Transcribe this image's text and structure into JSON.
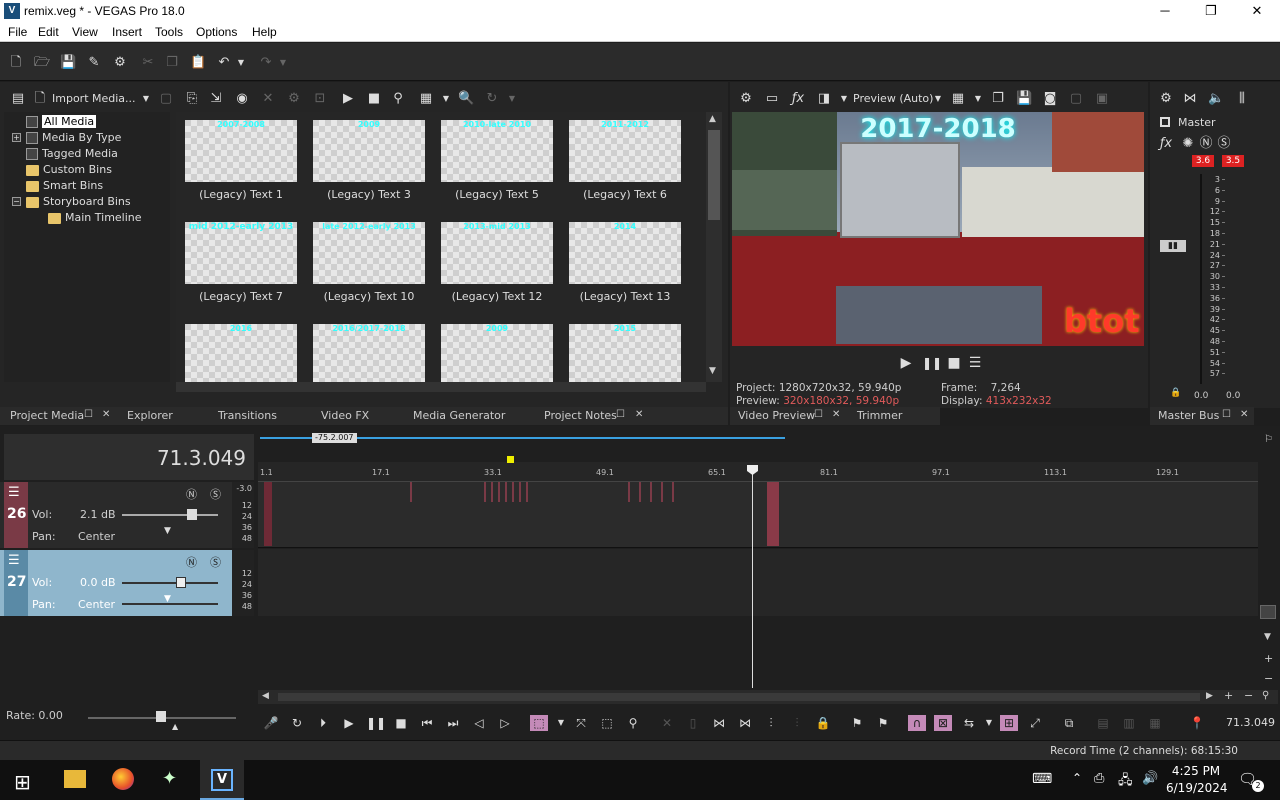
{
  "window": {
    "title": "remix.veg * - VEGAS Pro 18.0",
    "logo": "V",
    "minimize": "─",
    "maximize": "❐",
    "close": "✕"
  },
  "menu": [
    "File",
    "Edit",
    "View",
    "Insert",
    "Tools",
    "Options",
    "Help"
  ],
  "media_toolbar": {
    "import_label": "Import Media..."
  },
  "tree": {
    "items": [
      {
        "label": "All Media",
        "selected": true
      },
      {
        "label": "Media By Type",
        "expander": "+"
      },
      {
        "label": "Tagged Media"
      },
      {
        "label": "Custom Bins"
      },
      {
        "label": "Smart Bins"
      },
      {
        "label": "Storyboard Bins",
        "expander": "−"
      },
      {
        "label": "Main Timeline"
      }
    ]
  },
  "media": [
    {
      "thumb_text": "2007-2008",
      "label": "(Legacy) Text 1"
    },
    {
      "thumb_text": "2009",
      "label": "(Legacy) Text 3"
    },
    {
      "thumb_text": "2010-late 2010",
      "label": "(Legacy) Text 5"
    },
    {
      "thumb_text": "2011-2012",
      "label": "(Legacy) Text 6"
    },
    {
      "thumb_text": "mid 2012-early 2013",
      "label": "(Legacy) Text 7"
    },
    {
      "thumb_text": "late 2012-early 2013",
      "label": "(Legacy) Text 10"
    },
    {
      "thumb_text": "2013-mid 2013",
      "label": "(Legacy) Text 12"
    },
    {
      "thumb_text": "2014",
      "label": "(Legacy) Text 13"
    },
    {
      "thumb_text": "2016",
      "label": ""
    },
    {
      "thumb_text": "2016/2017-2018",
      "label": ""
    },
    {
      "thumb_text": "2009",
      "label": ""
    },
    {
      "thumb_text": "2015",
      "label": ""
    }
  ],
  "left_tabs": [
    "Project Media",
    "Explorer",
    "Transitions",
    "Video FX",
    "Media Generator",
    "Project Notes"
  ],
  "preview": {
    "mode": "Preview (Auto)",
    "overlay_year": "2017-2018",
    "overlay_logo": "btot",
    "project_label": "Project:",
    "project_value": "1280x720x32, 59.940p",
    "preview_label": "Preview:",
    "preview_value": "320x180x32, 59.940p",
    "frame_label": "Frame:",
    "frame_value": "7,264",
    "display_label": "Display:",
    "display_value": "413x232x32",
    "tabs": [
      "Video Preview",
      "Trimmer"
    ],
    "accent": "#e05a5a"
  },
  "master": {
    "label": "Master",
    "peak_left": "3.6",
    "peak_right": "3.5",
    "scale": [
      "3",
      "6",
      "9",
      "12",
      "15",
      "18",
      "21",
      "24",
      "27",
      "30",
      "33",
      "36",
      "39",
      "42",
      "45",
      "48",
      "51",
      "54",
      "57"
    ],
    "bottom_left": "0.0",
    "bottom_right": "0.0",
    "tab": "Master Bus"
  },
  "timeline": {
    "time": "71.3.049",
    "loop_label": "-75.2.007",
    "ruler": [
      "1.1",
      "17.1",
      "33.1",
      "49.1",
      "65.1",
      "81.1",
      "97.1",
      "113.1",
      "129.1"
    ],
    "tracks": [
      {
        "number": "26",
        "vol_label": "Vol:",
        "vol_value": "2.1 dB",
        "pan_label": "Pan:",
        "pan_value": "Center",
        "scale": [
          "-3.0",
          "12",
          "24",
          "36",
          "48"
        ],
        "color": "#7a3a46"
      },
      {
        "number": "27",
        "vol_label": "Vol:",
        "vol_value": "0.0 dB",
        "pan_label": "Pan:",
        "pan_value": "Center",
        "scale": [
          "12",
          "24",
          "36",
          "48"
        ],
        "color": "#8fb6cc"
      }
    ],
    "rate_label": "Rate: 0.00",
    "transport_time": "71.3.049",
    "status": "Record Time (2 channels): 68:15:30"
  },
  "taskbar": {
    "time": "4:25 PM",
    "date": "6/19/2024",
    "notif_count": "2"
  }
}
